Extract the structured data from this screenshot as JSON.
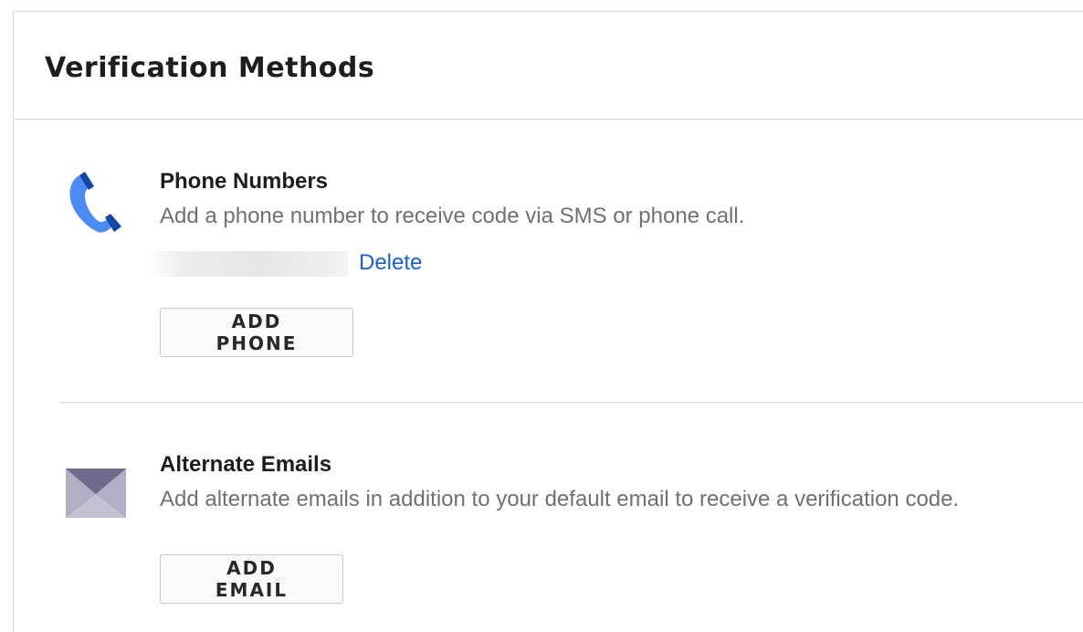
{
  "header": {
    "title": "Verification Methods"
  },
  "phone_section": {
    "icon": "phone-icon",
    "title": "Phone Numbers",
    "description": "Add a phone number to receive code via SMS or phone call.",
    "phone_entries": [
      {
        "delete_label": "Delete"
      }
    ],
    "add_button_label": "ADD PHONE"
  },
  "email_section": {
    "icon": "envelope-icon",
    "title": "Alternate Emails",
    "description": "Add alternate emails in addition to your default email to receive a verification code.",
    "add_button_label": "ADD EMAIL"
  },
  "colors": {
    "link": "#1a5fd0",
    "phone_icon_light": "#4a8bf5",
    "phone_icon_dark": "#1246a8",
    "envelope_light": "#b1aec5",
    "envelope_dark": "#6f6a8c",
    "divider": "#d8d8d8"
  }
}
